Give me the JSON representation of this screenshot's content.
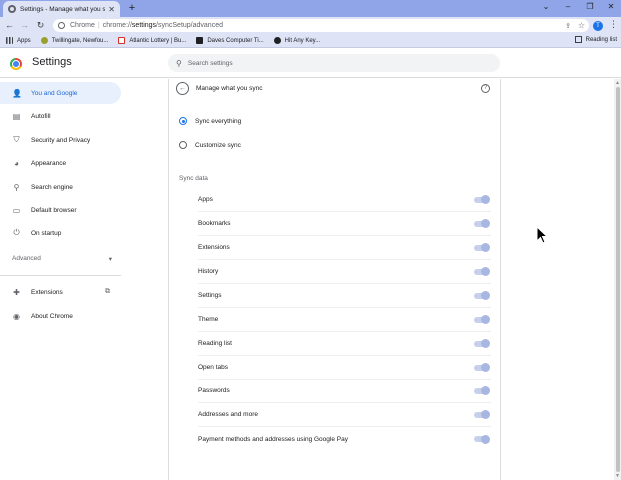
{
  "browser": {
    "tab_title": "Settings - Manage what you sync",
    "tab_close": "✕",
    "new_tab": "+",
    "omnibox_host": "Chrome",
    "omnibox_sep": "|",
    "omnibox_url_prefix": "chrome://",
    "omnibox_url_path": "settings",
    "omnibox_url_suffix": "/syncSetup/advanced",
    "profile_initial": "T",
    "bookmarks": [
      {
        "label": "Apps",
        "color": "#3c4043"
      },
      {
        "label": "Twillingate, Newfou...",
        "color": "#9aa02c"
      },
      {
        "label": "Atlantic Lottery | Bu...",
        "color": "#d93025"
      },
      {
        "label": "Daves Computer Ti...",
        "color": "#202124"
      },
      {
        "label": "Hit Any Key...",
        "color": "#202124"
      }
    ],
    "reading_list": "Reading list"
  },
  "header": {
    "title": "Settings",
    "search_placeholder": "Search settings"
  },
  "sidebar": {
    "items": [
      {
        "label": "You and Google",
        "icon": "person-icon"
      },
      {
        "label": "Autofill",
        "icon": "clipboard-icon"
      },
      {
        "label": "Security and Privacy",
        "icon": "shield-icon"
      },
      {
        "label": "Appearance",
        "icon": "palette-icon"
      },
      {
        "label": "Search engine",
        "icon": "search-icon"
      },
      {
        "label": "Default browser",
        "icon": "browser-icon"
      },
      {
        "label": "On startup",
        "icon": "power-icon"
      }
    ],
    "advanced": "Advanced",
    "extensions": "Extensions",
    "about": "About Chrome"
  },
  "main": {
    "title": "Manage what you sync",
    "options": [
      {
        "label": "Sync everything",
        "selected": true
      },
      {
        "label": "Customize sync",
        "selected": false
      }
    ],
    "section": "Sync data",
    "rows": [
      {
        "label": "Apps",
        "enabled": true
      },
      {
        "label": "Bookmarks",
        "enabled": true
      },
      {
        "label": "Extensions",
        "enabled": true
      },
      {
        "label": "History",
        "enabled": true
      },
      {
        "label": "Settings",
        "enabled": true
      },
      {
        "label": "Theme",
        "enabled": true
      },
      {
        "label": "Reading list",
        "enabled": true
      },
      {
        "label": "Open tabs",
        "enabled": true
      },
      {
        "label": "Passwords",
        "enabled": true
      },
      {
        "label": "Addresses and more",
        "enabled": true
      },
      {
        "label": "Payment methods and addresses using Google Pay",
        "enabled": true
      }
    ]
  },
  "colors": {
    "accent": "#1a73e8",
    "active_nav_bg": "#e8f0fe",
    "titlebar": "#8fa5e8",
    "toolbar": "#dee3f5"
  }
}
